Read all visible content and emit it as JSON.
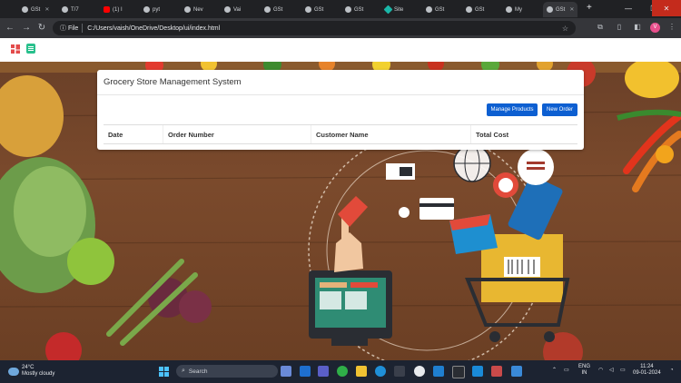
{
  "browser": {
    "tabs": [
      {
        "label": "GSt",
        "icon": "globe-icon"
      },
      {
        "label": "T/7",
        "icon": "globe-icon"
      },
      {
        "label": "(1) I",
        "icon": "youtube-icon"
      },
      {
        "label": "pyt",
        "icon": "github-icon"
      },
      {
        "label": "Nev",
        "icon": "globe-icon"
      },
      {
        "label": "Vai",
        "icon": "github-icon"
      },
      {
        "label": "GSt",
        "icon": "globe-icon"
      },
      {
        "label": "GSt",
        "icon": "globe-icon"
      },
      {
        "label": "GSt",
        "icon": "globe-icon"
      },
      {
        "label": "Site",
        "icon": "site-icon"
      },
      {
        "label": "GSt",
        "icon": "globe-icon"
      },
      {
        "label": "GSt",
        "icon": "globe-icon"
      },
      {
        "label": "My",
        "icon": "globe-icon"
      },
      {
        "label": "GSt",
        "icon": "globe-icon"
      }
    ],
    "address_chip": "File",
    "url": "C:/Users/vaish/OneDrive/Desktop/ui/index.html",
    "profile_initial": "V"
  },
  "app": {
    "card_title": "Grocery Store Management System",
    "manage_products_label": "Manage Products",
    "new_order_label": "New Order",
    "table_headers": [
      "Date",
      "Order Number",
      "Customer Name",
      "Total Cost"
    ]
  },
  "taskbar": {
    "weather_temp": "24°C",
    "weather_desc": "Mostly cloudy",
    "search_label": "Search",
    "lang_line1": "ENG",
    "lang_line2": "IN",
    "time": "11:24",
    "date": "09-01-2024"
  },
  "colors": {
    "primary_button": "#0d5fd1",
    "logo_red": "#e34b4b",
    "logo_green": "#28c08c",
    "close_button": "#c42b1c"
  }
}
